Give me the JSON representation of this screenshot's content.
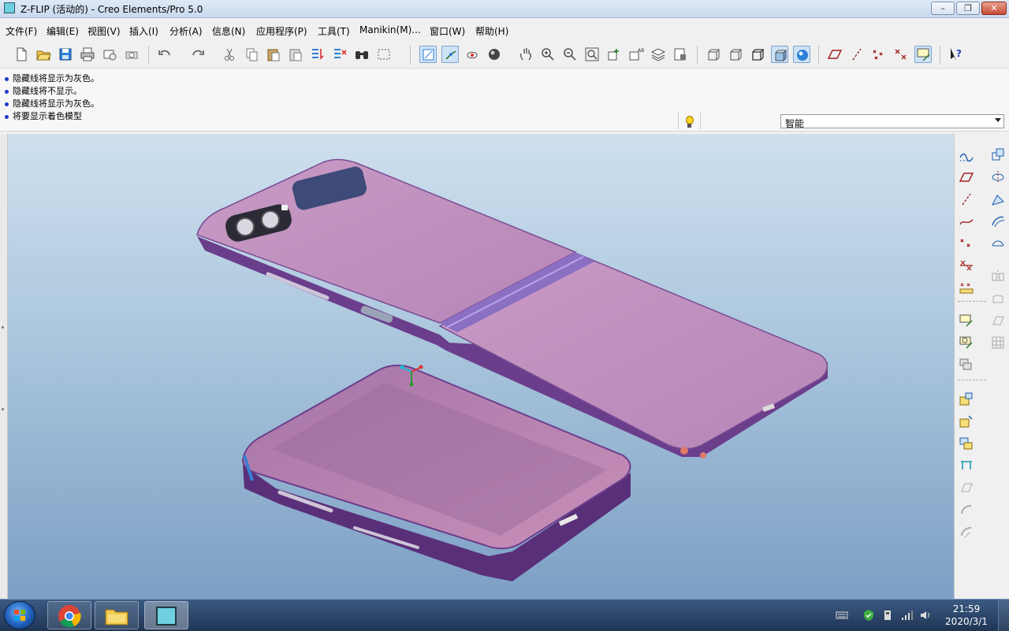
{
  "window": {
    "title": "Z-FLIP (活动的) - Creo Elements/Pro 5.0",
    "icon": "creo-app-icon",
    "controls": [
      "minimize-icon",
      "restore-icon",
      "close-icon"
    ]
  },
  "menu": {
    "items": [
      "文件(F)",
      "编辑(E)",
      "视图(V)",
      "插入(I)",
      "分析(A)",
      "信息(N)",
      "应用程序(P)",
      "工具(T)",
      "Manikin(M)...",
      "窗口(W)",
      "帮助(H)"
    ]
  },
  "toolbar": {
    "icons": [
      "new-file-icon",
      "open-folder-icon",
      "save-icon",
      "print-icon",
      "send-mail-icon",
      "quick-print-icon",
      "undo-icon",
      "redo-icon",
      "cut-icon",
      "copy-icon",
      "paste-icon",
      "paste-special-icon",
      "regenerate-icon",
      "regen-manager-icon",
      "find-icon",
      "select-box-icon",
      "redraw-icon",
      "spin-center-icon",
      "orient-mode-icon",
      "appearance-sphere-icon",
      "pan-hand-icon",
      "zoom-in-icon",
      "zoom-out-icon",
      "refit-icon",
      "reorient-icon",
      "named-views-icon",
      "layers-icon",
      "view-manager-icon",
      "wireframe-icon",
      "hidden-line-icon",
      "no-hidden-icon",
      "shading-icon",
      "enhanced-realism-icon",
      "datum-planes-icon",
      "datum-axes-icon",
      "datum-points-icon",
      "csys-icon",
      "annotations-icon",
      "context-help-icon"
    ]
  },
  "messages": {
    "lines": [
      "隐藏线将显示为灰色。",
      "隐藏线将不显示。",
      "隐藏线将显示为灰色。",
      "将要显示着色模型"
    ]
  },
  "filter": {
    "selected": "智能"
  },
  "right_toolbar": {
    "icons": [
      "sketch-curve-icon",
      "datum-plane-icon",
      "datum-axis-icon",
      "datum-curve-icon",
      "datum-point-icon",
      "datum-csys-icon",
      "analysis-icon",
      "note-icon",
      "style-icon",
      "view-options-icon",
      "copy-feature-icon",
      "paste-feature-icon",
      "mirror-icon",
      "extrude-icon",
      "revolve-icon",
      "sweep-icon",
      "blend-icon",
      "hole-icon",
      "shell-icon",
      "rib-icon",
      "draft-icon",
      "round-icon",
      "chamfer-icon",
      "pattern-icon",
      "merge-icon",
      "trim-icon",
      "offset-icon",
      "thicken-icon",
      "solidify-icon"
    ]
  },
  "taskbar": {
    "apps": [
      "chrome-icon",
      "file-explorer-icon",
      "creo-taskbar-icon"
    ],
    "tray_icons": [
      "keyboard-icon",
      "security-icon",
      "usb-icon",
      "network-icon",
      "volume-icon"
    ],
    "time": "21:59",
    "date": "2020/3/1"
  },
  "colors": {
    "phone_body": "#b77fb2",
    "phone_frame": "#6b3e8c",
    "viewport_top": "#cfe0ee",
    "viewport_bottom": "#7c9fc4",
    "taskbar": "#2a4468"
  }
}
